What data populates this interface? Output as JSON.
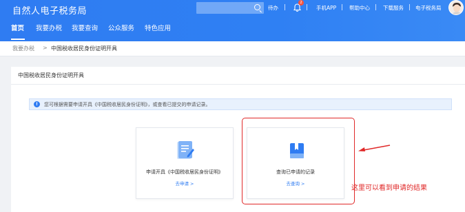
{
  "header": {
    "site_title": "自然人电子税务局",
    "links": [
      "待办",
      "手机APP",
      "帮助中心",
      "下载服务",
      "电子税务局"
    ],
    "bell_badge": "2",
    "accent_color": "#2f7cf2"
  },
  "nav": {
    "tabs": [
      "首页",
      "我要办税",
      "我要查询",
      "公众服务",
      "特色应用"
    ],
    "active": "首页"
  },
  "breadcrumb": {
    "parent": "我要办税",
    "separator": ">",
    "current": "中国税收居民身份证明开具"
  },
  "panel": {
    "title": "中国税收居民身份证明开具",
    "info": "您可根据需要申请开具《中国税收居民身份证明》，或查看已提交的申请记录。"
  },
  "cards": [
    {
      "label": "申请开具《中国税收居民身份证明》",
      "link": "去申请 >",
      "icon": "document-edit-icon"
    },
    {
      "label": "查询已申请的记录",
      "link": "去查询 >",
      "icon": "record-book-icon"
    }
  ],
  "annotation": {
    "text": "这里可以看到申请的结果",
    "color": "#e02828"
  }
}
